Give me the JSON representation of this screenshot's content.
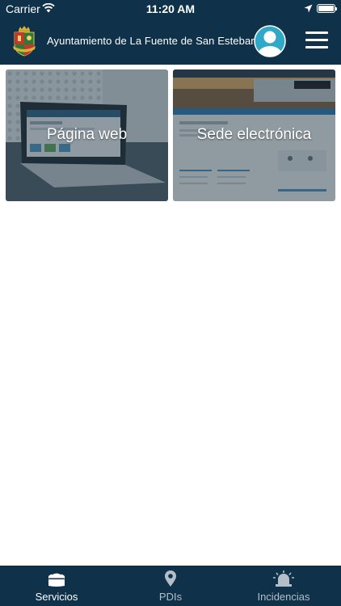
{
  "status_bar": {
    "carrier": "Carrier",
    "time": "11:20 AM"
  },
  "app_bar": {
    "title": "Ayuntamiento de La Fuente de San Esteban",
    "icons": [
      "crest-logo",
      "avatar-icon",
      "menu-icon"
    ]
  },
  "tiles": [
    {
      "label": "Página web",
      "icon": "laptop-photo"
    },
    {
      "label": "Sede electrónica",
      "icon": "screenshot-photo"
    }
  ],
  "tab_bar": {
    "active_index": 0,
    "tabs": [
      {
        "label": "Servicios",
        "icon": "services-icon"
      },
      {
        "label": "PDIs",
        "icon": "location-pin-icon"
      },
      {
        "label": "Incidencias",
        "icon": "siren-icon"
      }
    ]
  },
  "colors": {
    "primary": "#0f3149",
    "tab_inactive": "#b3bec8",
    "avatar_accent": "#2fa9c7"
  }
}
